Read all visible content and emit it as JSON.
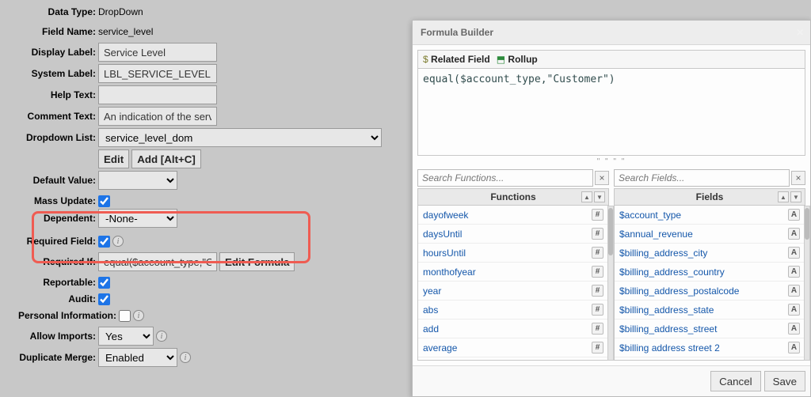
{
  "form": {
    "dataType": {
      "label": "Data Type:",
      "value": "DropDown"
    },
    "fieldName": {
      "label": "Field Name:",
      "value": "service_level"
    },
    "displayLabel": {
      "label": "Display Label:",
      "value": "Service Level"
    },
    "systemLabel": {
      "label": "System Label:",
      "value": "LBL_SERVICE_LEVEL"
    },
    "helpText": {
      "label": "Help Text:",
      "value": ""
    },
    "commentText": {
      "label": "Comment Text:",
      "value": "An indication of the servic"
    },
    "dropdownList": {
      "label": "Dropdown List:",
      "value": "service_level_dom",
      "editLabel": "Edit",
      "addLabel": "Add [Alt+C]"
    },
    "defaultValue": {
      "label": "Default Value:",
      "value": ""
    },
    "massUpdate": {
      "label": "Mass Update:",
      "checked": true
    },
    "dependent": {
      "label": "Dependent:",
      "value": "-None-"
    },
    "requiredField": {
      "label": "Required Field:",
      "checked": true
    },
    "requiredIf": {
      "label": "Required If:",
      "value": "equal($account_type,\"Cu",
      "buttonLabel": "Edit Formula"
    },
    "reportable": {
      "label": "Reportable:",
      "checked": true
    },
    "audit": {
      "label": "Audit:",
      "checked": true
    },
    "personalInfo": {
      "label": "Personal Information:",
      "checked": false
    },
    "allowImports": {
      "label": "Allow Imports:",
      "value": "Yes"
    },
    "duplicateMerge": {
      "label": "Duplicate Merge:",
      "value": "Enabled"
    }
  },
  "modal": {
    "title": "Formula Builder",
    "relatedFieldLabel": "Related Field",
    "rollupLabel": "Rollup",
    "formula": "equal($account_type,\"Customer\")",
    "searchFunctionsPlaceholder": "Search Functions...",
    "searchFieldsPlaceholder": "Search Fields...",
    "functionsHeader": "Functions",
    "fieldsHeader": "Fields",
    "functions": [
      {
        "name": "dayofweek",
        "badge": "#"
      },
      {
        "name": "daysUntil",
        "badge": "#"
      },
      {
        "name": "hoursUntil",
        "badge": "#"
      },
      {
        "name": "monthofyear",
        "badge": "#"
      },
      {
        "name": "year",
        "badge": "#"
      },
      {
        "name": "abs",
        "badge": "#"
      },
      {
        "name": "add",
        "badge": "#"
      },
      {
        "name": "average",
        "badge": "#"
      }
    ],
    "fields": [
      {
        "name": "$account_type",
        "badge": "A"
      },
      {
        "name": "$annual_revenue",
        "badge": "A"
      },
      {
        "name": "$billing_address_city",
        "badge": "A"
      },
      {
        "name": "$billing_address_country",
        "badge": "A"
      },
      {
        "name": "$billing_address_postalcode",
        "badge": "A"
      },
      {
        "name": "$billing_address_state",
        "badge": "A"
      },
      {
        "name": "$billing_address_street",
        "badge": "A"
      },
      {
        "name": "$billing address street 2",
        "badge": "A"
      }
    ],
    "cancelLabel": "Cancel",
    "saveLabel": "Save"
  }
}
